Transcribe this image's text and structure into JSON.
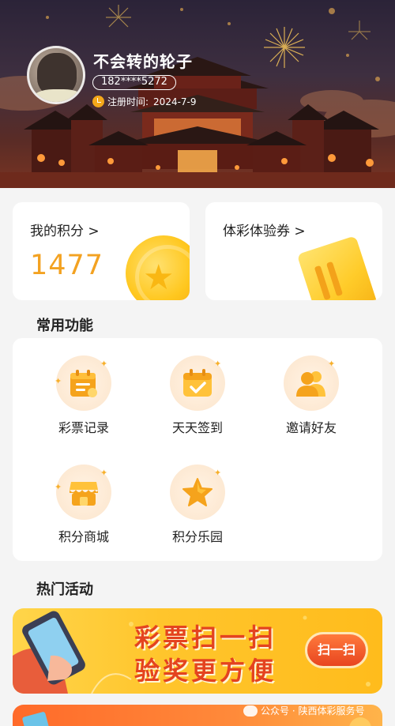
{
  "profile": {
    "username": "不会转的轮子",
    "phone": "182****5272",
    "register_label": "注册时间:",
    "register_date": "2024-7-9"
  },
  "cards": {
    "points_title": "我的积分 >",
    "points_value": "1477",
    "coupon_title": "体彩体验券 >"
  },
  "common_functions": {
    "title": "常用功能",
    "items": [
      {
        "label": "彩票记录",
        "icon": "ticket-record-icon"
      },
      {
        "label": "天天签到",
        "icon": "calendar-checkin-icon"
      },
      {
        "label": "邀请好友",
        "icon": "invite-friends-icon"
      },
      {
        "label": "积分商城",
        "icon": "shop-icon"
      },
      {
        "label": "积分乐园",
        "icon": "star-icon"
      }
    ]
  },
  "hot_activities": {
    "title": "热门活动",
    "banner_line1": "彩票扫一扫",
    "banner_line2": "验奖更方便",
    "banner_button": "扫一扫"
  },
  "watermark": "公众号 · 陕西体彩服务号",
  "colors": {
    "accent": "#f3a221",
    "banner_text": "#e4431f",
    "page_bg": "#f4f4f4"
  }
}
